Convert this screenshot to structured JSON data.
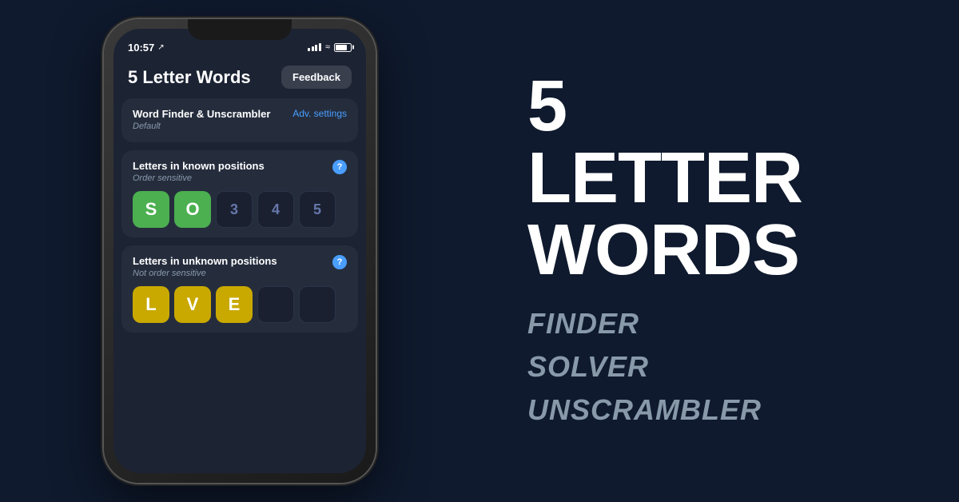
{
  "phone": {
    "status": {
      "time": "10:57",
      "location_icon": "↗"
    },
    "header": {
      "title": "5 Letter Words",
      "feedback_button": "Feedback"
    },
    "word_finder_card": {
      "title": "Word Finder & Unscrambler",
      "subtitle": "Default",
      "adv_settings": "Adv. settings"
    },
    "known_positions_card": {
      "title": "Letters in known positions",
      "subtitle": "Order sensitive",
      "tiles": [
        {
          "letter": "S",
          "type": "green"
        },
        {
          "letter": "O",
          "type": "green"
        },
        {
          "letter": "3",
          "type": "numbered"
        },
        {
          "letter": "4",
          "type": "numbered"
        },
        {
          "letter": "5",
          "type": "numbered"
        }
      ]
    },
    "unknown_positions_card": {
      "title": "Letters in unknown positions",
      "subtitle": "Not order sensitive",
      "tiles": [
        {
          "letter": "L",
          "type": "yellow"
        },
        {
          "letter": "V",
          "type": "yellow"
        },
        {
          "letter": "E",
          "type": "yellow"
        },
        {
          "letter": "",
          "type": "empty"
        },
        {
          "letter": "",
          "type": "empty"
        }
      ]
    }
  },
  "right_side": {
    "big_number": "5",
    "line1": "LETTER",
    "line2": "WORDS",
    "sub1": "FINDER",
    "sub2": "SOLVER",
    "sub3": "UNSCRAMBLER"
  }
}
